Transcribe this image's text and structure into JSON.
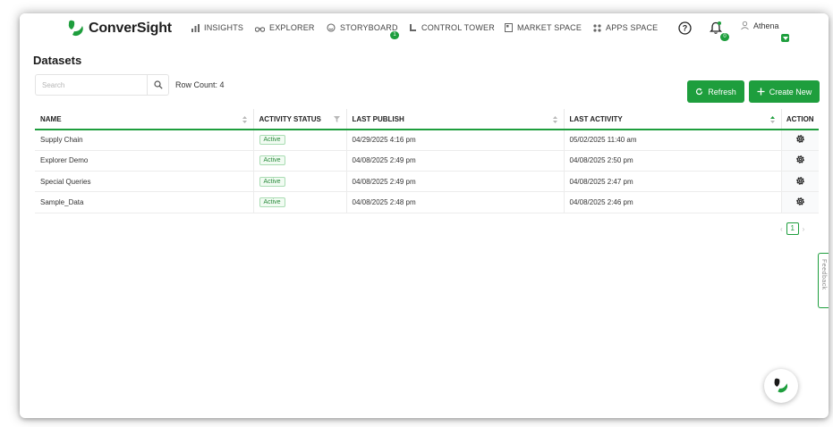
{
  "brand": {
    "name": "ConverSight"
  },
  "nav": [
    {
      "label": "INSIGHTS",
      "icon": "bar-chart-icon"
    },
    {
      "label": "EXPLORER",
      "icon": "binoculars-icon"
    },
    {
      "label": "STORYBOARD",
      "icon": "storyboard-icon",
      "badge": "1"
    },
    {
      "label": "CONTROL TOWER",
      "icon": "tower-icon"
    },
    {
      "label": "MARKET SPACE",
      "icon": "market-icon"
    },
    {
      "label": "APPS SPACE",
      "icon": "apps-grid-icon"
    }
  ],
  "header": {
    "help_icon": "help-circle-icon",
    "bell_icon": "bell-icon",
    "notification_count": "0",
    "user_name": "Athena"
  },
  "page": {
    "title": "Datasets"
  },
  "search": {
    "placeholder": "Search",
    "value": ""
  },
  "row_count": "Row Count: 4",
  "buttons": {
    "refresh": "Refresh",
    "create_new": "Create New"
  },
  "table": {
    "columns": [
      "NAME",
      "ACTIVITY STATUS",
      "LAST PUBLISH",
      "LAST ACTIVITY",
      "ACTION"
    ],
    "rows": [
      {
        "name": "Supply Chain",
        "status": "Active",
        "last_publish": "04/29/2025 4:16 pm",
        "last_activity": "05/02/2025 11:40 am"
      },
      {
        "name": "Explorer Demo",
        "status": "Active",
        "last_publish": "04/08/2025 2:49 pm",
        "last_activity": "04/08/2025 2:50 pm"
      },
      {
        "name": "Special Queries",
        "status": "Active",
        "last_publish": "04/08/2025 2:49 pm",
        "last_activity": "04/08/2025 2:47 pm"
      },
      {
        "name": "Sample_Data",
        "status": "Active",
        "last_publish": "04/08/2025 2:48 pm",
        "last_activity": "04/08/2025 2:46 pm"
      }
    ]
  },
  "pagination": {
    "current_page": "1"
  },
  "feedback": {
    "label": "Feedback"
  },
  "colors": {
    "accent": "#1e9e3d"
  }
}
